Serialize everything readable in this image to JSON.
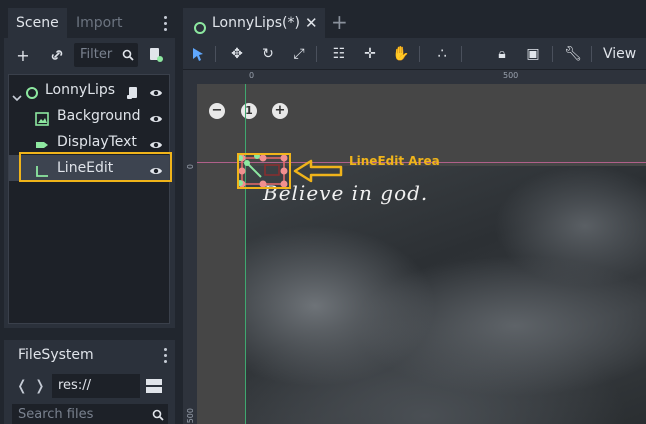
{
  "left_dock": {
    "scene_tab": "Scene",
    "import_tab": "Import",
    "filter_placeholder": "Filter",
    "tree": [
      {
        "label": "LonnyLips",
        "icon": "node2d-icon"
      },
      {
        "label": "Background",
        "icon": "texture-rect-icon"
      },
      {
        "label": "DisplayText",
        "icon": "label-icon"
      },
      {
        "label": "LineEdit",
        "icon": "line-edit-icon"
      }
    ],
    "filesystem_tab": "FileSystem",
    "path": "res://",
    "search_placeholder": "Search files"
  },
  "editor": {
    "scene_tab": "LonnyLips(*)",
    "view_menu": "View",
    "ruler_top": [
      "0",
      "500"
    ],
    "ruler_left": [
      "0",
      "500"
    ],
    "zoom_reset": "1",
    "canvas_text": "Believe in god.",
    "annotation": "LineEdit Area"
  },
  "colors": {
    "accent": "#f0b41a",
    "guide_green": "#3fa86f",
    "guide_pink": "#b0608a",
    "node_green": "#8de8a0"
  }
}
